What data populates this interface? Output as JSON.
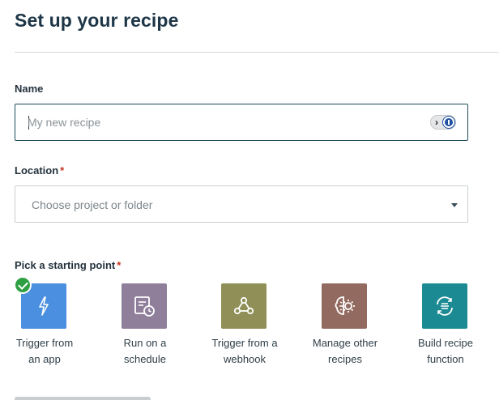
{
  "page": {
    "title": "Set up your recipe"
  },
  "name": {
    "label": "Name",
    "placeholder": "My new recipe",
    "value": ""
  },
  "location": {
    "label": "Location",
    "required_mark": "*",
    "placeholder": "Choose project or folder"
  },
  "starting_point": {
    "label": "Pick a starting point",
    "required_mark": "*",
    "selected": "Trigger from an app",
    "options": [
      {
        "line1": "Trigger from",
        "line2": "an app",
        "color": "#4a8fe0",
        "icon": "lightning-icon"
      },
      {
        "line1": "Run on a",
        "line2": "schedule",
        "color": "#8f7f9b",
        "icon": "schedule-icon"
      },
      {
        "line1": "Trigger from a",
        "line2": "webhook",
        "color": "#8f8f57",
        "icon": "webhook-icon"
      },
      {
        "line1": "Manage other",
        "line2": "recipes",
        "color": "#926a5f",
        "icon": "brain-gear-icon"
      },
      {
        "line1": "Build recipe",
        "line2": "function",
        "color": "#1b8a93",
        "icon": "function-icon"
      }
    ]
  }
}
